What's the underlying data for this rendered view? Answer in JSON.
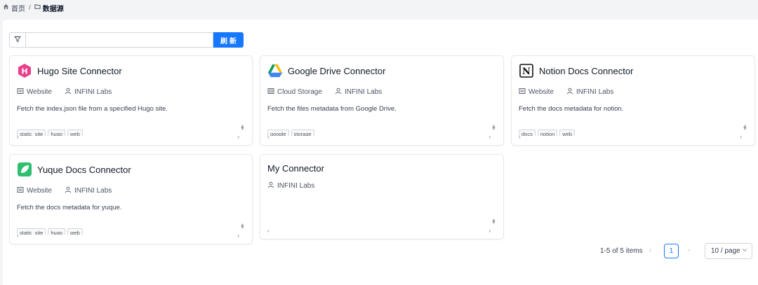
{
  "breadcrumb": {
    "home": "首页",
    "separator": "/",
    "current": "数据源"
  },
  "toolbar": {
    "search_placeholder": "",
    "refresh_label": "刷新"
  },
  "cards": [
    {
      "title": "Hugo Site Connector",
      "logo": "hugo-logo",
      "category": "Website",
      "author": "INFINI Labs",
      "description": "Fetch the index.json file from a specified Hugo site.",
      "tags": [
        "static_site",
        "hugo",
        "web"
      ]
    },
    {
      "title": "Google Drive Connector",
      "logo": "google-drive-logo",
      "category": "Cloud Storage",
      "author": "INFINI Labs",
      "description": "Fetch the files metadata from Google Drive.",
      "tags": [
        "google",
        "storage"
      ]
    },
    {
      "title": "Notion Docs Connector",
      "logo": "notion-logo",
      "category": "Website",
      "author": "INFINI Labs",
      "description": "Fetch the docs metadata for notion.",
      "tags": [
        "docs",
        "notion",
        "web"
      ]
    },
    {
      "title": "Yuque Docs Connector",
      "logo": "yuque-logo",
      "category": "Website",
      "author": "INFINI Labs",
      "description": "Fetch the docs metadata for yuque.",
      "tags": [
        "static_site",
        "hugo",
        "web"
      ]
    },
    {
      "title": "My Connector",
      "author": "INFINI Labs"
    }
  ],
  "pagination": {
    "total_text": "1-5 of 5 items",
    "current_page": "1",
    "page_size": "10 / page"
  },
  "colors": {
    "primary": "#1677ff",
    "hugo": "#e83e8c",
    "yuque": "#2fbf71"
  }
}
